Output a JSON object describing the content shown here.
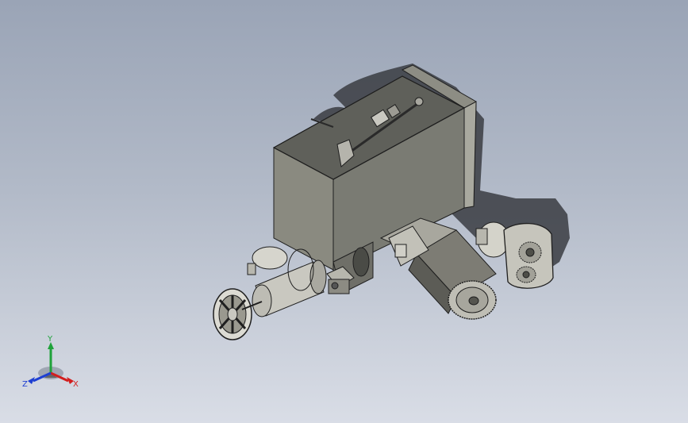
{
  "viewport": {
    "background_top": "#9aa4b6",
    "background_bottom": "#d9dde6",
    "model_colors": {
      "hopper": "#8a8a80",
      "hopper_dark": "#5f605a",
      "hopper_inner": "#6e6f68",
      "metal": "#c9c8c0",
      "metal_dark": "#8f8e86",
      "outline": "#1f1f1f",
      "shadow": "#3a3c42"
    }
  },
  "triad": {
    "x_label": "X",
    "y_label": "Y",
    "z_label": "Z",
    "x_color": "#d21e1e",
    "y_color": "#1fa23a",
    "z_color": "#1e3fd2"
  }
}
